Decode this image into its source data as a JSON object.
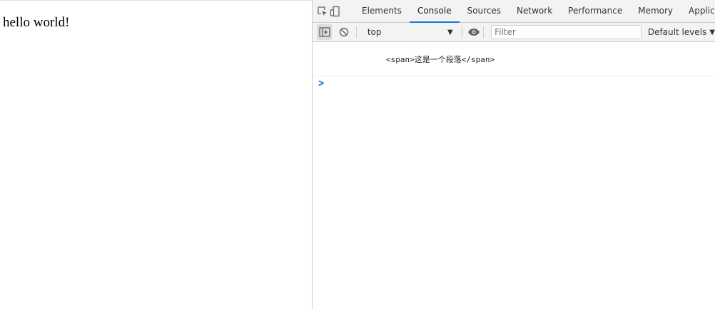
{
  "page": {
    "text": "hello world!"
  },
  "devtools": {
    "tabs": [
      {
        "label": "Elements"
      },
      {
        "label": "Console"
      },
      {
        "label": "Sources"
      },
      {
        "label": "Network"
      },
      {
        "label": "Performance"
      },
      {
        "label": "Memory"
      },
      {
        "label": "Applicatio"
      }
    ],
    "active_tab": "Console",
    "toolbar": {
      "context": "top",
      "filter_placeholder": "Filter",
      "levels_label": "Default levels"
    },
    "console": {
      "messages": [
        {
          "text": "<span>这是一个段落</span>"
        }
      ],
      "prompt_symbol": ">"
    },
    "colors": {
      "accent": "#1a73e8",
      "panel_bg": "#f3f3f3",
      "border": "#cccccc"
    },
    "icons": [
      "inspect-element-icon",
      "device-toolbar-icon",
      "sidebar-toggle-icon",
      "clear-console-icon",
      "live-expression-eye-icon",
      "dropdown-arrow-icon"
    ]
  }
}
